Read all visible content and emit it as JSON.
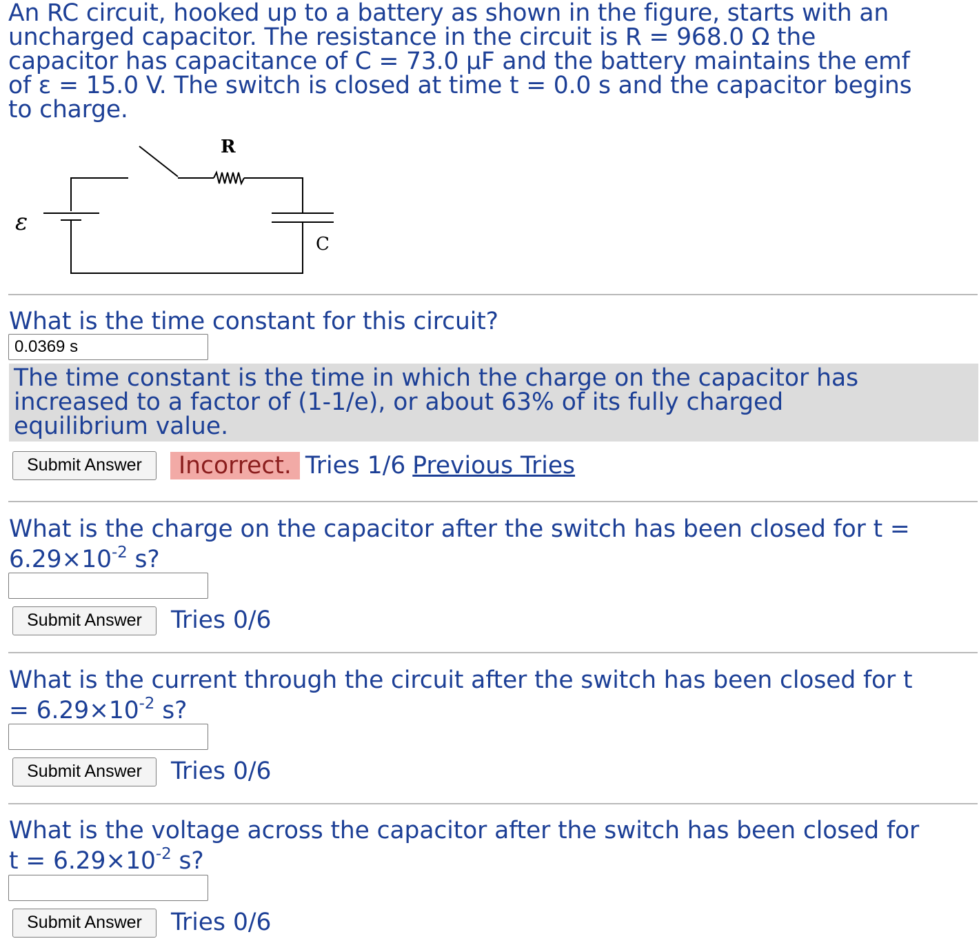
{
  "intro": {
    "line1": "An RC circuit, hooked up to a battery as shown in the figure, starts with an",
    "line2a": "uncharged capacitor. The resistance in the circuit is R = 968.0 ",
    "ohm_symbol": "Ω",
    "line2b": " the",
    "line3a": "capacitor has capacitance of C = 73.0 ",
    "micro_symbol": "μ",
    "line3b": "F and the battery maintains the emf",
    "line4a": "of ",
    "emf_symbol": "ε",
    "line4b": " = 15.0 V. The switch is closed at time t = 0.0 s and the capacitor begins",
    "line5": "to charge."
  },
  "figure": {
    "resistor_label": "R",
    "capacitor_label": "C",
    "emf_label": "ε"
  },
  "q1": {
    "question": "What is the time constant for this circuit?",
    "answer_value": "0.0369 s",
    "hint_line1": "The time constant is the time in which the charge on the capacitor has",
    "hint_line2": "increased to a factor of (1-1/e), or about 63% of its fully charged",
    "hint_line3": "equilibrium value.",
    "submit": "Submit Answer",
    "result": "Incorrect.",
    "tries": "Tries 1/6",
    "previous": "Previous Tries"
  },
  "q2": {
    "question_a": "What is the charge on the capacitor after the switch has been closed for t =",
    "question_b": "6.29×10",
    "exp": "-2",
    "question_c": " s?",
    "answer_value": "",
    "submit": "Submit Answer",
    "tries": "Tries 0/6"
  },
  "q3": {
    "question_a": "What is the current through the circuit after the switch has been closed for t",
    "question_b": "= 6.29×10",
    "exp": "-2",
    "question_c": " s?",
    "answer_value": "",
    "submit": "Submit Answer",
    "tries": "Tries 0/6"
  },
  "q4": {
    "question_a": "What is the voltage across the capacitor after the switch has been closed for",
    "question_b": "t = 6.29×10",
    "exp": "-2",
    "question_c": " s?",
    "answer_value": "",
    "submit": "Submit Answer",
    "tries": "Tries 0/6"
  }
}
